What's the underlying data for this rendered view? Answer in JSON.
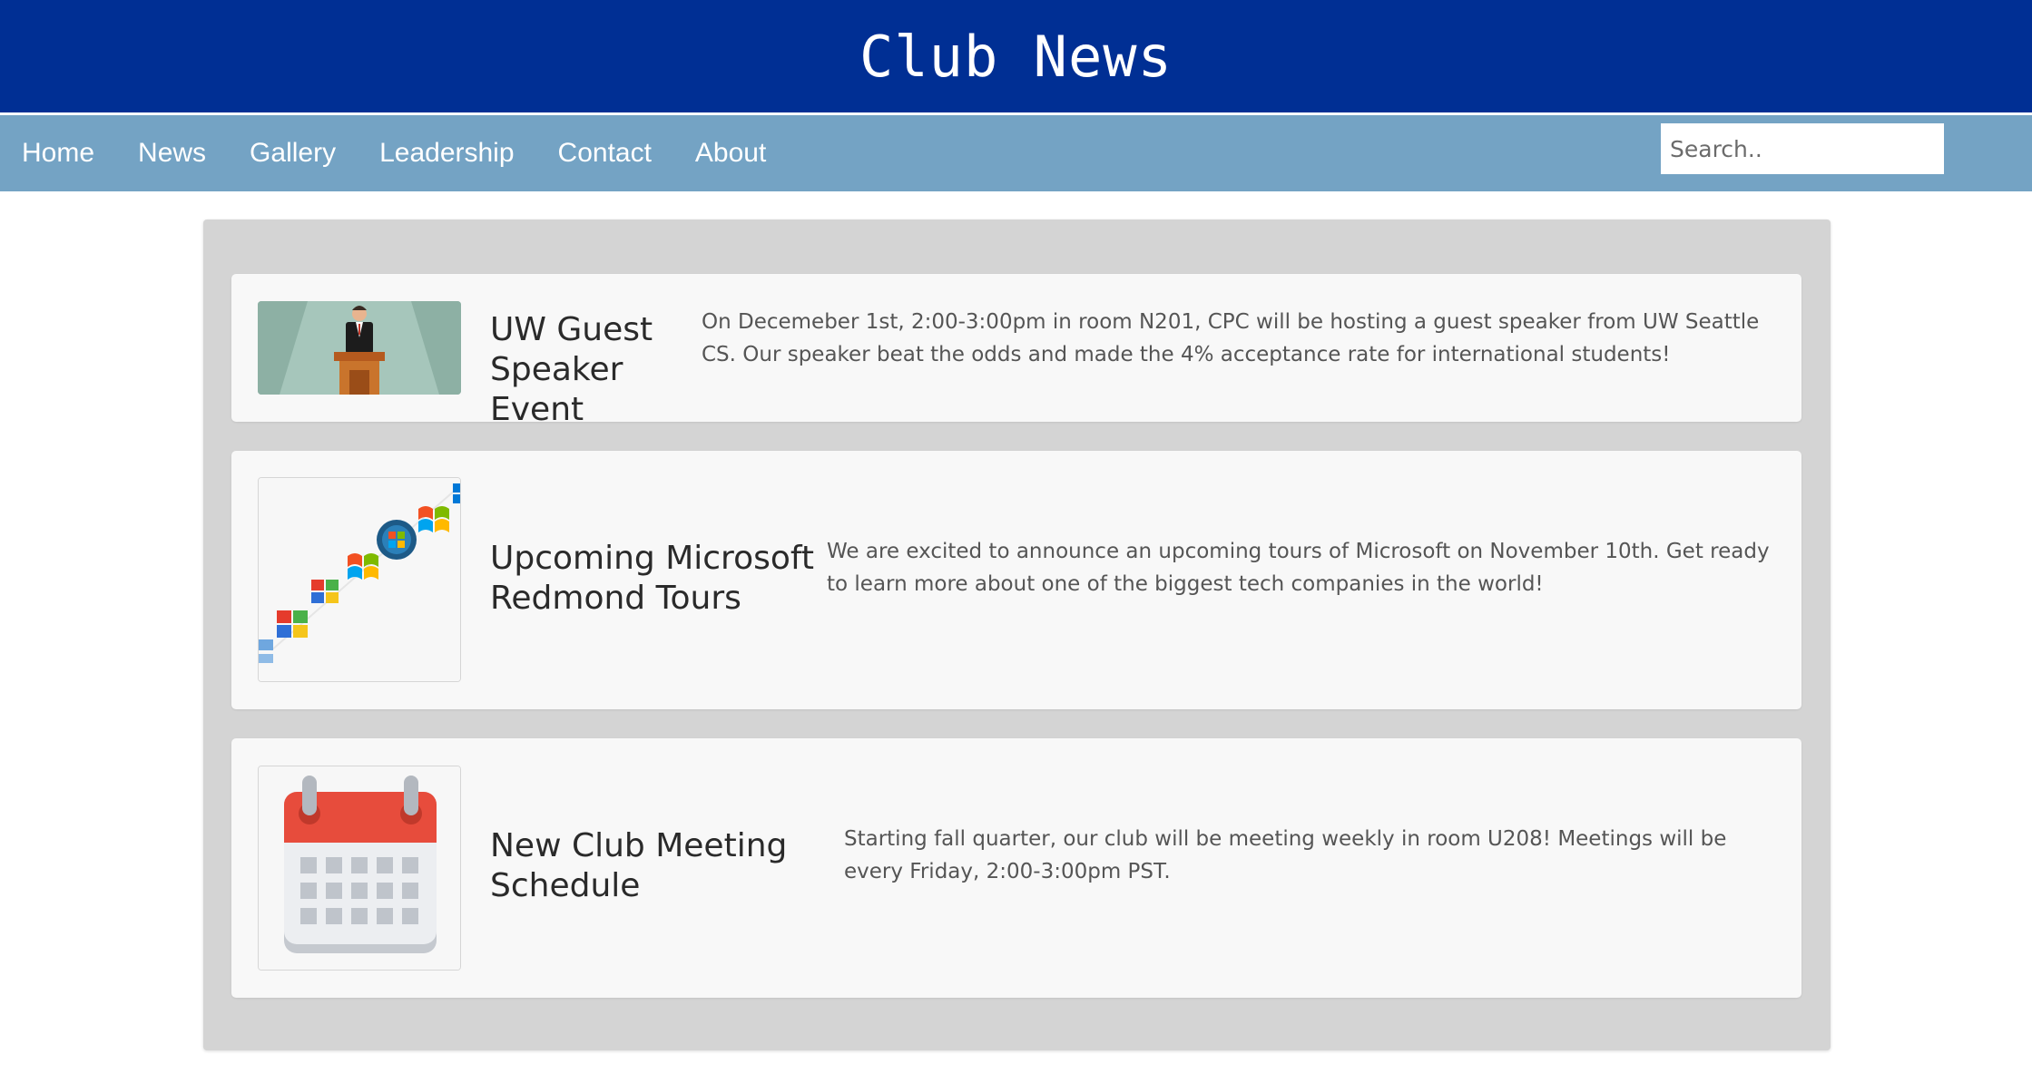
{
  "header": {
    "title": "Club News"
  },
  "nav": {
    "items": [
      "Home",
      "News",
      "Gallery",
      "Leadership",
      "Contact",
      "About"
    ],
    "search_placeholder": "Search.."
  },
  "posts": [
    {
      "title": "UW Guest Speaker Event",
      "description": "On Decemeber 1st, 2:00-3:00pm in room N201, CPC will be hosting a guest speaker from UW Seattle CS. Our speaker beat the odds and made the 4% acceptance rate for international students!",
      "image_icon": "speaker-podium-icon"
    },
    {
      "title": "Upcoming Microsoft Redmond Tours",
      "description": "We are excited to announce an upcoming tours of Microsoft on November 10th. Get ready to learn more about one of the biggest tech companies in the world!",
      "image_icon": "windows-logos-icon"
    },
    {
      "title": "New Club Meeting Schedule",
      "description": "Starting fall quarter, our club will be meeting weekly in room U208! Meetings will be every Friday, 2:00-3:00pm PST.",
      "image_icon": "calendar-icon"
    }
  ],
  "colors": {
    "header_bg": "#002f94",
    "nav_bg": "#74a3c4",
    "panel_bg": "#d4d4d4",
    "card_bg": "#f8f8f8"
  }
}
